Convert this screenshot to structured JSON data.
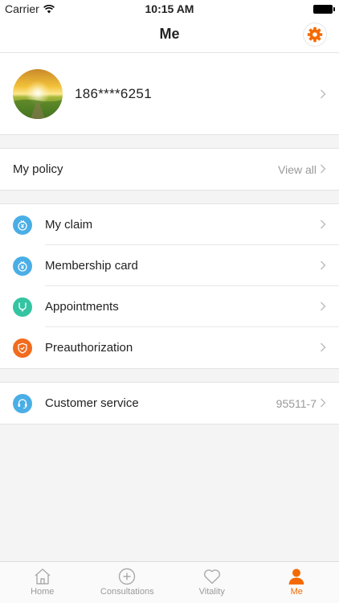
{
  "status_bar": {
    "carrier": "Carrier",
    "time": "10:15 AM"
  },
  "nav": {
    "title": "Me"
  },
  "profile": {
    "phone": "186****6251"
  },
  "policy": {
    "label": "My policy",
    "action": "View all"
  },
  "menu": [
    {
      "label": "My claim",
      "icon": "yuan-icon",
      "color": "#4aaee6"
    },
    {
      "label": "Membership card",
      "icon": "yuan-icon",
      "color": "#4aaee6"
    },
    {
      "label": "Appointments",
      "icon": "stethoscope-icon",
      "color": "#34c4a2"
    },
    {
      "label": "Preauthorization",
      "icon": "shield-icon",
      "color": "#f26b1d"
    }
  ],
  "service": {
    "label": "Customer service",
    "phone": "95511-7",
    "icon": "headset-icon",
    "color": "#4aaee6"
  },
  "tabs": [
    {
      "label": "Home",
      "icon": "home-icon"
    },
    {
      "label": "Consultations",
      "icon": "plus-circle-icon"
    },
    {
      "label": "Vitality",
      "icon": "heart-icon"
    },
    {
      "label": "Me",
      "icon": "person-icon",
      "active": true
    }
  ],
  "colors": {
    "accent": "#f56a00",
    "inactive": "#999999"
  }
}
